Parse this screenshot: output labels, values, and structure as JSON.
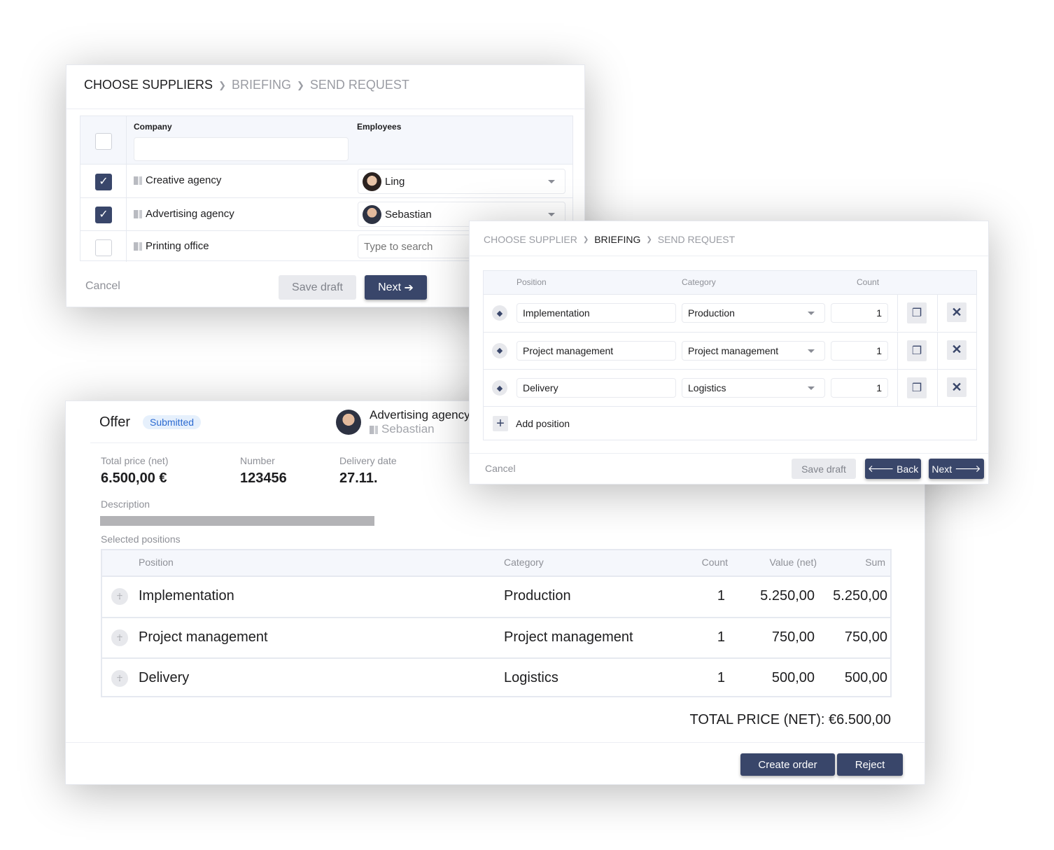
{
  "suppliers": {
    "breadcrumb": [
      "CHOOSE SUPPLIERS",
      "BRIEFING",
      "SEND REQUEST"
    ],
    "columns": {
      "company": "Company",
      "employees": "Employees"
    },
    "company_filter_value": "",
    "rows": [
      {
        "company": "Creative agency",
        "checked": true,
        "employee": "Ling"
      },
      {
        "company": "Advertising agency",
        "checked": true,
        "employee": "Sebastian"
      },
      {
        "company": "Printing office",
        "checked": false,
        "employee": ""
      }
    ],
    "employee_placeholder": "Type to search",
    "cancel": "Cancel",
    "save_draft": "Save draft",
    "next": "Next"
  },
  "briefing": {
    "breadcrumb": [
      "CHOOSE SUPPLIER",
      "BRIEFING",
      "SEND REQUEST"
    ],
    "columns": {
      "position": "Position",
      "category": "Category",
      "count": "Count"
    },
    "rows": [
      {
        "position": "Implementation",
        "category": "Production",
        "count": "1"
      },
      {
        "position": "Project management",
        "category": "Project management",
        "count": "1"
      },
      {
        "position": "Delivery",
        "category": "Logistics",
        "count": "1"
      }
    ],
    "add_position": "Add position",
    "cancel": "Cancel",
    "save_draft": "Save draft",
    "back": "Back",
    "next": "Next"
  },
  "offer": {
    "title": "Offer",
    "status": "Submitted",
    "supplier_company": "Advertising agency",
    "supplier_contact": "Sebastian",
    "total_price_label": "Total price (net)",
    "total_price": "6.500,00 €",
    "number_label": "Number",
    "number": "123456",
    "delivery_label": "Delivery date",
    "delivery": "27.11.",
    "description_label": "Description",
    "selected_label": "Selected positions",
    "columns": {
      "position": "Position",
      "category": "Category",
      "count": "Count",
      "value": "Value (net)",
      "sum": "Sum"
    },
    "rows": [
      {
        "position": "Implementation",
        "category": "Production",
        "count": "1",
        "value": "5.250,00",
        "sum": "5.250,00"
      },
      {
        "position": "Project management",
        "category": "Project management",
        "count": "1",
        "value": "750,00",
        "sum": "750,00"
      },
      {
        "position": "Delivery",
        "category": "Logistics",
        "count": "1",
        "value": "500,00",
        "sum": "500,00"
      }
    ],
    "total_line": "TOTAL PRICE (NET): €6.500,00",
    "create_order": "Create order",
    "reject": "Reject"
  },
  "colors": {
    "primary": "#39466a",
    "badge_bg": "#e6f0fc",
    "badge_text": "#2c6bd1"
  }
}
